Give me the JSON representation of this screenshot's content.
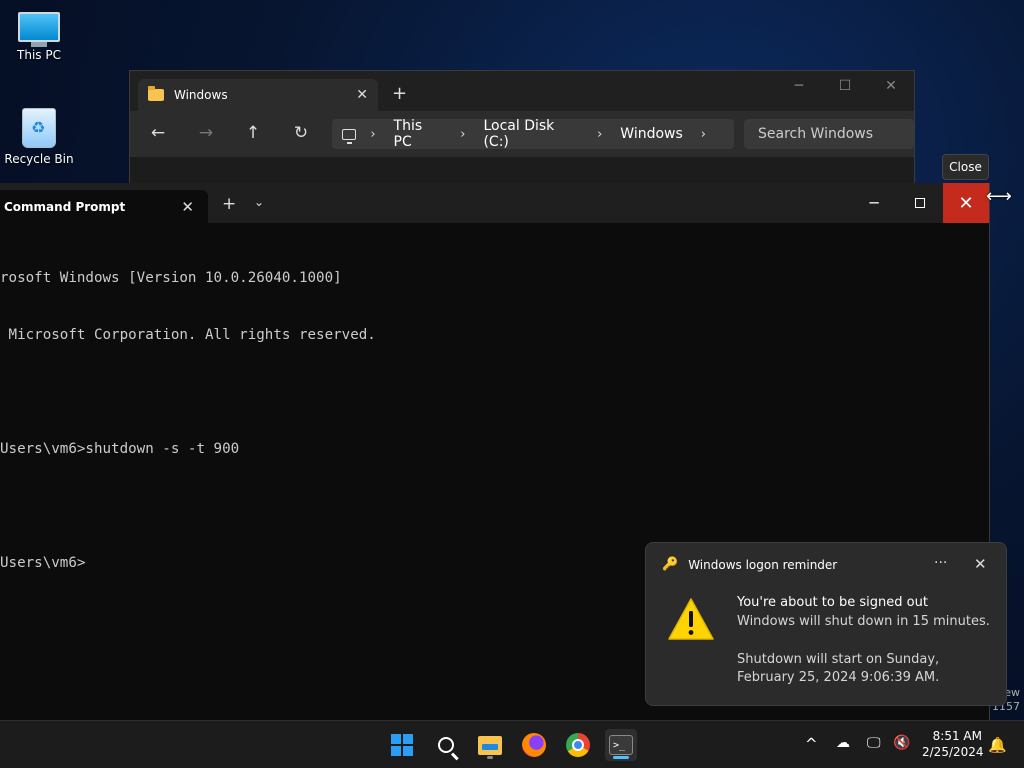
{
  "desktop": {
    "icons": [
      {
        "label": "This PC"
      },
      {
        "label": "Recycle Bin"
      }
    ]
  },
  "explorer": {
    "tab_title": "Windows",
    "tab_close": "✕",
    "new_tab": "+",
    "window_controls": {
      "minimize": "─",
      "maximize": "☐",
      "close": "✕"
    },
    "nav": {
      "back": "←",
      "forward": "→",
      "up": "↑",
      "refresh": "↻"
    },
    "breadcrumb": [
      "This PC",
      "Local Disk (C:)",
      "Windows"
    ],
    "breadcrumb_sep": "›",
    "search_placeholder": "Search Windows"
  },
  "tooltip": {
    "text": "Close"
  },
  "terminal": {
    "tab_title": "Command Prompt",
    "tab_close": "✕",
    "new_tab": "+",
    "dropdown": "⌄",
    "window_controls": {
      "minimize": "─",
      "close": "✕"
    },
    "lines": [
      "rosoft Windows [Version 10.0.26040.1000]",
      " Microsoft Corporation. All rights reserved.",
      "",
      "Users\\vm6>shutdown -s -t 900",
      "",
      "Users\\vm6>"
    ]
  },
  "notification": {
    "app_name": "Windows logon reminder",
    "more": "···",
    "close": "✕",
    "title": "You're about to be signed out",
    "body": "Windows will shut down in 15 minutes.",
    "detail": " Shutdown will start on Sunday, February 25, 2024 9:06:39 AM."
  },
  "edge_text": {
    "line1": "ew",
    "line2": "1157"
  },
  "taskbar": {
    "apps": [
      {
        "name": "start"
      },
      {
        "name": "search"
      },
      {
        "name": "file-explorer"
      },
      {
        "name": "firefox"
      },
      {
        "name": "chrome"
      },
      {
        "name": "terminal",
        "glyph": ">_"
      }
    ],
    "tray": {
      "overflow": "^"
    },
    "clock": {
      "time": "8:51 AM",
      "date": "2/25/2024"
    }
  },
  "colors": {
    "accent": "#4cc2ff",
    "close_red": "#c42b1c",
    "warning": "#ffd400"
  }
}
